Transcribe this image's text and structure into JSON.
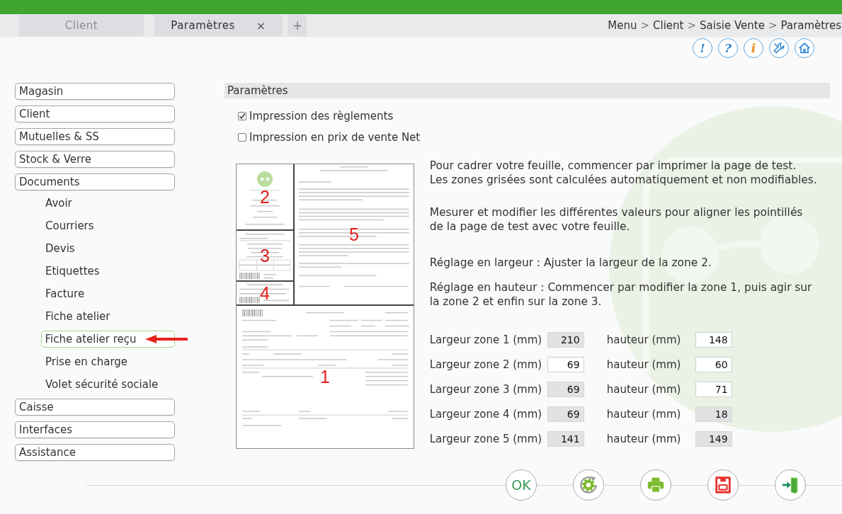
{
  "tabs": [
    {
      "label": "Client",
      "selected": false
    },
    {
      "label": "Paramètres",
      "selected": true,
      "close": "×"
    }
  ],
  "new_tab": "+",
  "breadcrumb": {
    "items": [
      "Menu",
      "Client",
      "Saisie Vente",
      "Paramètres"
    ],
    "separator": ">"
  },
  "toolbar": [
    {
      "kind": "alert",
      "glyph": "!"
    },
    {
      "kind": "help",
      "glyph": "?"
    },
    {
      "kind": "info",
      "glyph": "i"
    },
    {
      "kind": "tools"
    },
    {
      "kind": "home"
    }
  ],
  "sidebar": {
    "items": [
      {
        "label": "Magasin"
      },
      {
        "label": "Client"
      },
      {
        "label": "Mutuelles & SS"
      },
      {
        "label": "Stock & Verre"
      },
      {
        "label": "Documents",
        "children": [
          {
            "label": "Avoir",
            "selected": false,
            "marked": false
          },
          {
            "label": "Courriers",
            "selected": false,
            "marked": false
          },
          {
            "label": "Devis",
            "selected": false,
            "marked": false
          },
          {
            "label": "Etiquettes",
            "selected": false,
            "marked": false
          },
          {
            "label": "Facture",
            "selected": false,
            "marked": false
          },
          {
            "label": "Fiche atelier",
            "selected": false,
            "marked": false
          },
          {
            "label": "Fiche atelier reçu",
            "selected": true,
            "marked": true
          },
          {
            "label": "Prise en charge",
            "selected": false,
            "marked": false
          },
          {
            "label": "Volet sécurité sociale",
            "selected": false,
            "marked": false
          }
        ]
      },
      {
        "label": "Caisse"
      },
      {
        "label": "Interfaces"
      },
      {
        "label": "Assistance"
      }
    ]
  },
  "panel": {
    "title": "Paramètres",
    "options": [
      {
        "label": "Impression des règlements",
        "checked": true
      },
      {
        "label": "Impression en prix de vente Net",
        "checked": false
      }
    ],
    "preview": {
      "zones": [
        {
          "kind": "header",
          "label": "2"
        },
        {
          "kind": "letter",
          "label": "5"
        },
        {
          "kind": "coupon",
          "label": "3"
        },
        {
          "kind": "tag",
          "label": "4"
        },
        {
          "kind": "form",
          "label": "1"
        }
      ]
    },
    "instructions": [
      "Pour cadrer votre feuille, commencer par imprimer la page de test.\nLes zones grisées sont calculées automatiquement et non modifiables.",
      "Mesurer et modifier les différentes valeurs pour aligner les pointillés\nde la page de test avec votre feuille.",
      "Réglage en largeur : Ajuster la largeur de la zone 2.",
      "Réglage en hauteur : Commencer par modifier la zone 1, puis agir sur\nla zone 2 et enfin sur la zone 3."
    ],
    "zone_sizes": [
      {
        "width": {
          "label": "Largeur zone 1 (mm)",
          "value": "210",
          "disabled": true
        },
        "height": {
          "label": "hauteur (mm)",
          "value": "148",
          "disabled": false
        }
      },
      {
        "width": {
          "label": "Largeur zone 2 (mm)",
          "value": "69",
          "disabled": false
        },
        "height": {
          "label": "hauteur (mm)",
          "value": "60",
          "disabled": false
        }
      },
      {
        "width": {
          "label": "Largeur zone 3 (mm)",
          "value": "69",
          "disabled": true
        },
        "height": {
          "label": "hauteur (mm)",
          "value": "71",
          "disabled": false
        }
      },
      {
        "width": {
          "label": "Largeur zone 4 (mm)",
          "value": "69",
          "disabled": true
        },
        "height": {
          "label": "hauteur (mm)",
          "value": "18",
          "disabled": true
        }
      },
      {
        "width": {
          "label": "Largeur zone 5 (mm)",
          "value": "141",
          "disabled": true
        },
        "height": {
          "label": "hauteur (mm)",
          "value": "149",
          "disabled": true
        }
      }
    ]
  },
  "actions": [
    {
      "kind": "ok",
      "label": "OK"
    },
    {
      "kind": "reset"
    },
    {
      "kind": "print"
    },
    {
      "kind": "save"
    },
    {
      "kind": "exit"
    }
  ]
}
